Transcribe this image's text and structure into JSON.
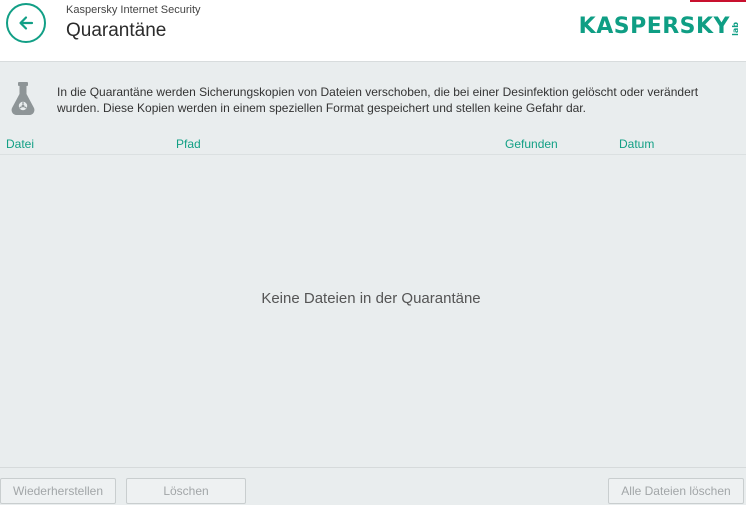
{
  "header": {
    "app_name": "Kaspersky Internet Security",
    "page_title": "Quarantäne",
    "logo_text": "KASPERSKY",
    "logo_sub": "lab",
    "accent_color": "#129f86",
    "brand_red": "#c8102e"
  },
  "info": {
    "icon": "flask-biohazard-icon",
    "text_line1": "In die Quarantäne werden Sicherungskopien von Dateien verschoben, die bei einer Desinfektion gelöscht oder verändert",
    "text_line2": "wurden. Diese Kopien werden in einem speziellen Format gespeichert und stellen keine Gefahr dar."
  },
  "table": {
    "columns": [
      "Datei",
      "Pfad",
      "Gefunden",
      "Datum"
    ],
    "rows": [],
    "empty_message": "Keine Dateien in der Quarantäne"
  },
  "footer": {
    "restore_label": "Wiederherstellen",
    "delete_label": "Löschen",
    "delete_all_label": "Alle Dateien löschen"
  }
}
